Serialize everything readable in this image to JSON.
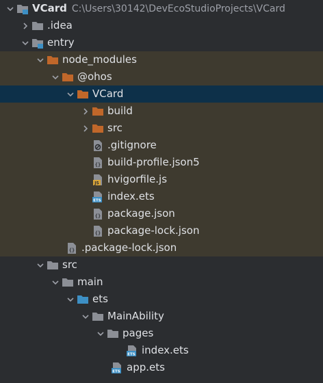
{
  "tree": {
    "root": {
      "label": "VCard",
      "path": "C:\\Users\\30142\\DevEcoStudioProjects\\VCard"
    },
    "idea": {
      "label": ".idea"
    },
    "entry": {
      "label": "entry"
    },
    "node_modules": {
      "label": "node_modules"
    },
    "ohos": {
      "label": "@ohos"
    },
    "vcard": {
      "label": "VCard"
    },
    "build": {
      "label": "build"
    },
    "src_inner": {
      "label": "src"
    },
    "gitignore": {
      "label": ".gitignore"
    },
    "build_profile": {
      "label": "build-profile.json5"
    },
    "hvigorfile": {
      "label": "hvigorfile.js"
    },
    "index_ets_inner": {
      "label": "index.ets"
    },
    "package_json": {
      "label": "package.json"
    },
    "package_lock_inner": {
      "label": "package-lock.json"
    },
    "package_lock_hidden": {
      "label": ".package-lock.json"
    },
    "src": {
      "label": "src"
    },
    "main": {
      "label": "main"
    },
    "ets": {
      "label": "ets"
    },
    "mainability": {
      "label": "MainAbility"
    },
    "pages": {
      "label": "pages"
    },
    "index_ets": {
      "label": "index.ets"
    },
    "app_ets": {
      "label": "app.ets"
    }
  },
  "colors": {
    "background": "#2b2d30",
    "excluded_row": "#3e3a2f",
    "selected_row": "#0d3049",
    "excluded_folder": "#c0672a",
    "source_folder": "#3d8fc4",
    "plain_folder": "#8c8f96",
    "text": "#dfe1e5",
    "path_text": "#9da0a8"
  },
  "icons": {
    "folder": "folder-icon",
    "module": "module-folder-icon",
    "file": "file-icon",
    "json": "json-file-icon",
    "js": "js-file-icon",
    "ets": "ets-file-icon",
    "ignore": "ignore-file-icon"
  }
}
